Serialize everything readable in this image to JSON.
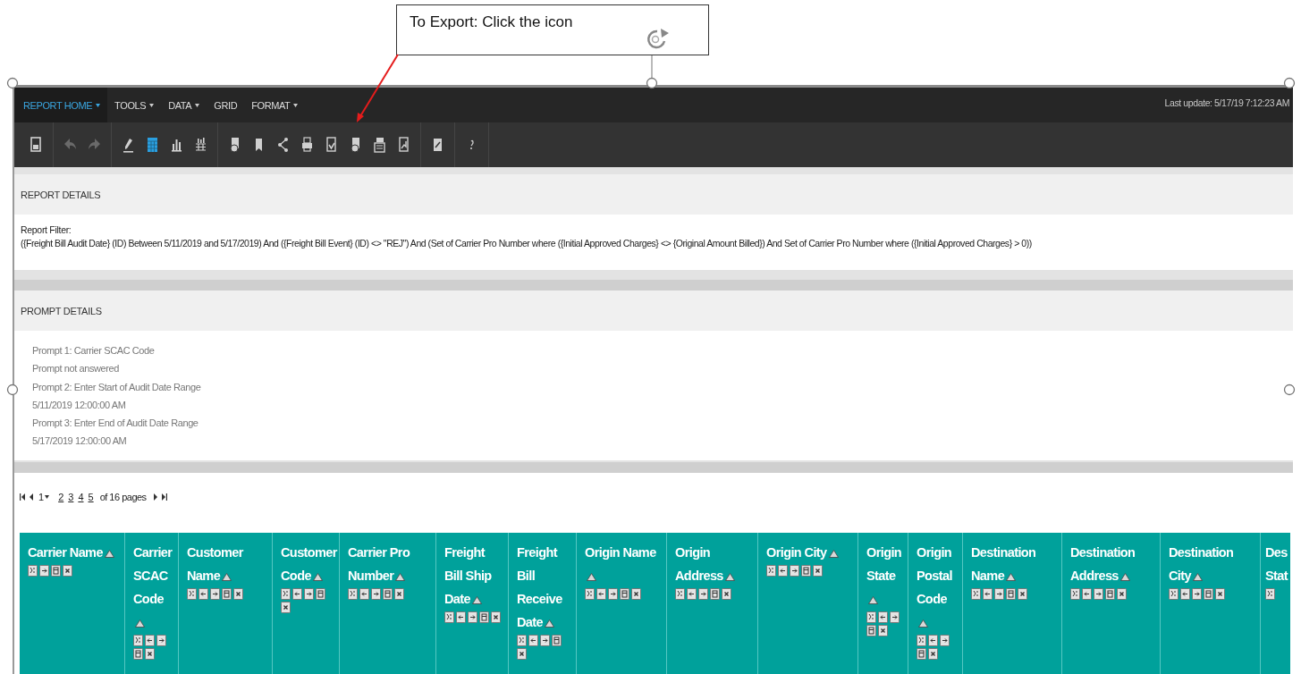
{
  "callout": {
    "text": "To Export: Click the icon"
  },
  "menu": [
    {
      "label": "REPORT HOME",
      "selected": true,
      "dropdown": true
    },
    {
      "label": "TOOLS",
      "selected": false,
      "dropdown": true
    },
    {
      "label": "DATA",
      "selected": false,
      "dropdown": true
    },
    {
      "label": "GRID",
      "selected": false,
      "dropdown": false
    },
    {
      "label": "FORMAT",
      "selected": false,
      "dropdown": true
    }
  ],
  "last_update": "Last update: 5/17/19 7:12:23 AM",
  "toolbar": [
    [
      {
        "kind": "save",
        "selected": false,
        "disabled": false
      }
    ],
    [
      {
        "kind": "undo",
        "selected": false,
        "disabled": true
      },
      {
        "kind": "redo",
        "selected": false,
        "disabled": true
      }
    ],
    [
      {
        "kind": "pencil",
        "selected": false,
        "disabled": false
      },
      {
        "kind": "grid",
        "selected": true,
        "disabled": false
      },
      {
        "kind": "bars",
        "selected": false,
        "disabled": false
      },
      {
        "kind": "bars-grid",
        "selected": false,
        "disabled": false
      }
    ],
    [
      {
        "kind": "doc-clock",
        "selected": false,
        "disabled": false
      },
      {
        "kind": "bookmark",
        "selected": false,
        "disabled": false
      },
      {
        "kind": "share",
        "selected": false,
        "disabled": false
      },
      {
        "kind": "print",
        "selected": false,
        "disabled": false
      },
      {
        "kind": "doc-check",
        "selected": false,
        "disabled": false
      },
      {
        "kind": "doc-clock",
        "selected": false,
        "disabled": false
      },
      {
        "kind": "doc-export",
        "selected": false,
        "disabled": false
      },
      {
        "kind": "doc-chart",
        "selected": false,
        "disabled": false
      }
    ],
    [
      {
        "kind": "doc-edit",
        "selected": false,
        "disabled": false
      }
    ],
    [
      {
        "kind": "help",
        "selected": false,
        "disabled": false
      }
    ]
  ],
  "report_details": {
    "title": "REPORT DETAILS",
    "filter_label": "Report Filter:",
    "filter": "({Freight Bill Audit Date} (ID) Between 5/11/2019 and 5/17/2019) And ({Freight Bill Event} (ID) <> \"REJ\") And (Set of  Carrier Pro Number where ({Initial Approved Charges} <> {Original Amount Billed}) And Set of  Carrier Pro Number where ({Initial Approved Charges} > 0))"
  },
  "prompt_details": {
    "title": "PROMPT DETAILS",
    "lines": [
      "Prompt 1: Carrier SCAC Code",
      "Prompt not answered",
      "Prompt 2: Enter Start of Audit Date Range",
      "5/11/2019 12:00:00 AM",
      "Prompt 3: Enter End of Audit Date Range",
      "5/17/2019 12:00:00 AM"
    ]
  },
  "pager": {
    "pages": [
      {
        "label": "1",
        "selected": true
      },
      {
        "label": "2",
        "selected": false
      },
      {
        "label": "3",
        "selected": false
      },
      {
        "label": "4",
        "selected": false
      },
      {
        "label": "5",
        "selected": false
      }
    ],
    "summary": "of 16 pages"
  },
  "columns": [
    {
      "label": "Carrier Name",
      "tools": [
        {
          "kind": "filter"
        },
        {
          "kind": "right"
        },
        {
          "kind": "pivot"
        },
        {
          "kind": "remove"
        }
      ]
    },
    {
      "label": "Carrier SCAC Code",
      "tools": [
        {
          "kind": "filter"
        },
        {
          "kind": "left"
        },
        {
          "kind": "right"
        },
        {
          "kind": "pivot"
        },
        {
          "kind": "remove"
        }
      ]
    },
    {
      "label": "Customer Name",
      "tools": [
        {
          "kind": "filter"
        },
        {
          "kind": "left"
        },
        {
          "kind": "right"
        },
        {
          "kind": "pivot"
        },
        {
          "kind": "remove"
        }
      ]
    },
    {
      "label": "Customer Code",
      "tools": [
        {
          "kind": "filter"
        },
        {
          "kind": "left"
        },
        {
          "kind": "right"
        },
        {
          "kind": "pivot"
        },
        {
          "kind": "remove"
        }
      ]
    },
    {
      "label": "Carrier Pro Number",
      "tools": [
        {
          "kind": "filter"
        },
        {
          "kind": "left"
        },
        {
          "kind": "right"
        },
        {
          "kind": "pivot"
        },
        {
          "kind": "remove"
        }
      ]
    },
    {
      "label": "Freight Bill Ship Date",
      "tools": [
        {
          "kind": "filter"
        },
        {
          "kind": "left"
        },
        {
          "kind": "right"
        },
        {
          "kind": "pivot"
        },
        {
          "kind": "remove"
        }
      ]
    },
    {
      "label": "Freight Bill Receive Date",
      "tools": [
        {
          "kind": "filter"
        },
        {
          "kind": "left"
        },
        {
          "kind": "right"
        },
        {
          "kind": "pivot"
        },
        {
          "kind": "remove"
        }
      ]
    },
    {
      "label": "Origin Name",
      "tools": [
        {
          "kind": "filter"
        },
        {
          "kind": "left"
        },
        {
          "kind": "right"
        },
        {
          "kind": "pivot"
        },
        {
          "kind": "remove"
        }
      ]
    },
    {
      "label": "Origin Address",
      "tools": [
        {
          "kind": "filter"
        },
        {
          "kind": "left"
        },
        {
          "kind": "right"
        },
        {
          "kind": "pivot"
        },
        {
          "kind": "remove"
        }
      ]
    },
    {
      "label": "Origin City",
      "tools": [
        {
          "kind": "filter"
        },
        {
          "kind": "left"
        },
        {
          "kind": "right"
        },
        {
          "kind": "pivot"
        },
        {
          "kind": "remove"
        }
      ]
    },
    {
      "label": "Origin State",
      "tools": [
        {
          "kind": "filter"
        },
        {
          "kind": "left"
        },
        {
          "kind": "right"
        },
        {
          "kind": "pivot"
        },
        {
          "kind": "remove"
        }
      ]
    },
    {
      "label": "Origin Postal Code",
      "tools": [
        {
          "kind": "filter"
        },
        {
          "kind": "left"
        },
        {
          "kind": "right"
        },
        {
          "kind": "pivot"
        },
        {
          "kind": "remove"
        }
      ]
    },
    {
      "label": "Destination Name",
      "tools": [
        {
          "kind": "filter"
        },
        {
          "kind": "left"
        },
        {
          "kind": "right"
        },
        {
          "kind": "pivot"
        },
        {
          "kind": "remove"
        }
      ]
    },
    {
      "label": "Destination Address",
      "tools": [
        {
          "kind": "filter"
        },
        {
          "kind": "left"
        },
        {
          "kind": "right"
        },
        {
          "kind": "pivot"
        },
        {
          "kind": "remove"
        }
      ]
    },
    {
      "label": "Destination City",
      "tools": [
        {
          "kind": "filter"
        },
        {
          "kind": "left"
        },
        {
          "kind": "right"
        },
        {
          "kind": "pivot"
        },
        {
          "kind": "remove"
        }
      ]
    },
    {
      "label": "Des Stat",
      "tools": [
        {
          "kind": "filter"
        }
      ]
    }
  ]
}
